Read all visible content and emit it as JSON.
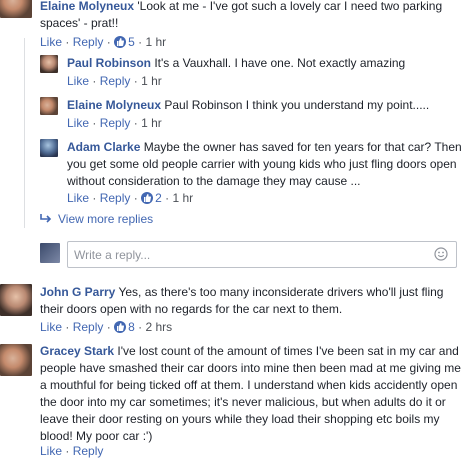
{
  "comments": [
    {
      "name": "Elaine Molyneux",
      "text": "'Look at me - I've got such a lovely car I need two parking spaces' - prat!!",
      "like": "Like",
      "reply": "Reply",
      "reactions": "5",
      "time": "1 hr"
    },
    {
      "name": "Paul Robinson",
      "text": "It's a Vauxhall. I have one. Not exactly amazing",
      "like": "Like",
      "reply": "Reply",
      "time": "1 hr"
    },
    {
      "name": "Elaine Molyneux",
      "text": "Paul Robinson I think you understand my point.....",
      "like": "Like",
      "reply": "Reply",
      "time": "1 hr"
    },
    {
      "name": "Adam Clarke",
      "text": "Maybe the owner has saved for ten years for that car? Then you get some old people carrier with young kids who just fling doors open without consideration to the damage they may cause ...",
      "like": "Like",
      "reply": "Reply",
      "reactions": "2",
      "time": "1 hr"
    },
    {
      "name": "John G Parry",
      "text": "Yes, as there's too many inconsiderate drivers who'll just fling their doors open with no regards for the car next to them.",
      "like": "Like",
      "reply": "Reply",
      "reactions": "8",
      "time": "2 hrs"
    },
    {
      "name": "Gracey Stark",
      "text": "I've lost count of the amount of times I've been sat in my car and people have smashed their car doors into mine then been mad at me giving me a mouthful for being ticked off at them. I understand when kids accidently open the door into my car sometimes; it's never malicious, but when adults do it or leave their door resting on yours while they load their shopping etc boils my blood! My poor car :')",
      "like": "Like",
      "reply": "Reply"
    }
  ],
  "view_more": "View more replies",
  "reply_placeholder": "Write a reply...",
  "separator": "·",
  "colors": {
    "link": "#365899",
    "action": "#4267b2",
    "badge": "#4267b2"
  },
  "icons": [
    "like-icon",
    "reply-arrow-icon",
    "emoji-icon"
  ]
}
